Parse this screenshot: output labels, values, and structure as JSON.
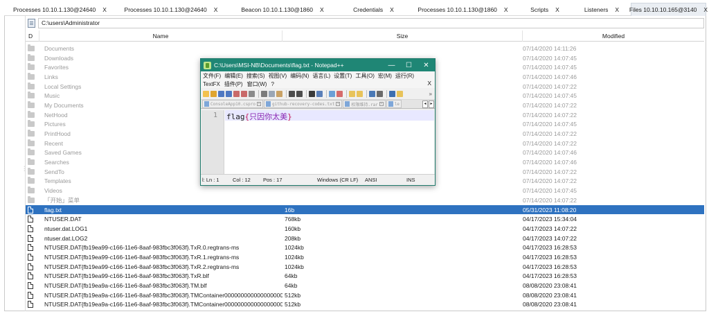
{
  "tabs": [
    {
      "label": "Processes 10.10.1.130@24640",
      "close": "X",
      "active": false
    },
    {
      "label": "Processes 10.10.1.130@24640",
      "close": "X",
      "active": false
    },
    {
      "label": "Beacon 10.10.1.130@1860",
      "close": "X",
      "active": false
    },
    {
      "label": "Credentials",
      "close": "X",
      "active": false
    },
    {
      "label": "Processes 10.10.1.130@1860",
      "close": "X",
      "active": false
    },
    {
      "label": "Scripts",
      "close": "X",
      "active": false
    },
    {
      "label": "Listeners",
      "close": "X",
      "active": false
    },
    {
      "label": "Files 10.10.10.165@3140",
      "close": "X",
      "active": true
    }
  ],
  "browser": {
    "path": "C:\\users\\Administrator",
    "columns": {
      "d": "D",
      "name": "Name",
      "size": "Size",
      "modified": "Modified"
    },
    "rows": [
      {
        "type": "folder",
        "name": "Documents",
        "size": "",
        "modified": "07/14/2020 14:11:26"
      },
      {
        "type": "folder",
        "name": "Downloads",
        "size": "",
        "modified": "07/14/2020 14:07:45"
      },
      {
        "type": "folder",
        "name": "Favorites",
        "size": "",
        "modified": "07/14/2020 14:07:45"
      },
      {
        "type": "folder",
        "name": "Links",
        "size": "",
        "modified": "07/14/2020 14:07:46"
      },
      {
        "type": "folder",
        "name": "Local Settings",
        "size": "",
        "modified": "07/14/2020 14:07:22"
      },
      {
        "type": "folder",
        "name": "Music",
        "size": "",
        "modified": "07/14/2020 14:07:45"
      },
      {
        "type": "folder",
        "name": "My Documents",
        "size": "",
        "modified": "07/14/2020 14:07:22"
      },
      {
        "type": "folder",
        "name": "NetHood",
        "size": "",
        "modified": "07/14/2020 14:07:22"
      },
      {
        "type": "folder",
        "name": "Pictures",
        "size": "",
        "modified": "07/14/2020 14:07:45"
      },
      {
        "type": "folder",
        "name": "PrintHood",
        "size": "",
        "modified": "07/14/2020 14:07:22"
      },
      {
        "type": "folder",
        "name": "Recent",
        "size": "",
        "modified": "07/14/2020 14:07:22"
      },
      {
        "type": "folder",
        "name": "Saved Games",
        "size": "",
        "modified": "07/14/2020 14:07:46"
      },
      {
        "type": "folder",
        "name": "Searches",
        "size": "",
        "modified": "07/14/2020 14:07:46"
      },
      {
        "type": "folder",
        "name": "SendTo",
        "size": "",
        "modified": "07/14/2020 14:07:22"
      },
      {
        "type": "folder",
        "name": "Templates",
        "size": "",
        "modified": "07/14/2020 14:07:22"
      },
      {
        "type": "folder",
        "name": "Videos",
        "size": "",
        "modified": "07/14/2020 14:07:45"
      },
      {
        "type": "folder",
        "name": "「开始」菜单",
        "size": "",
        "modified": "07/14/2020 14:07:22"
      },
      {
        "type": "file",
        "name": "flag.txt",
        "size": "16b",
        "modified": "05/31/2023 11:08:20",
        "selected": true
      },
      {
        "type": "file",
        "name": "NTUSER.DAT",
        "size": "768kb",
        "modified": "04/17/2023 15:34:04"
      },
      {
        "type": "file",
        "name": "ntuser.dat.LOG1",
        "size": "160kb",
        "modified": "04/17/2023 14:07:22"
      },
      {
        "type": "file",
        "name": "ntuser.dat.LOG2",
        "size": "208kb",
        "modified": "04/17/2023 14:07:22"
      },
      {
        "type": "file",
        "name": "NTUSER.DAT{fb19ea99-c166-11e6-8aaf-983fbc3f063f}.TxR.0.regtrans-ms",
        "size": "1024kb",
        "modified": "04/17/2023 16:28:53"
      },
      {
        "type": "file",
        "name": "NTUSER.DAT{fb19ea99-c166-11e6-8aaf-983fbc3f063f}.TxR.1.regtrans-ms",
        "size": "1024kb",
        "modified": "04/17/2023 16:28:53"
      },
      {
        "type": "file",
        "name": "NTUSER.DAT{fb19ea99-c166-11e6-8aaf-983fbc3f063f}.TxR.2.regtrans-ms",
        "size": "1024kb",
        "modified": "04/17/2023 16:28:53"
      },
      {
        "type": "file",
        "name": "NTUSER.DAT{fb19ea99-c166-11e6-8aaf-983fbc3f063f}.TxR.blf",
        "size": "64kb",
        "modified": "04/17/2023 16:28:53"
      },
      {
        "type": "file",
        "name": "NTUSER.DAT{fb19ea9a-c166-11e6-8aaf-983fbc3f063f}.TM.blf",
        "size": "64kb",
        "modified": "08/08/2020 23:08:41"
      },
      {
        "type": "file",
        "name": "NTUSER.DAT{fb19ea9a-c166-11e6-8aaf-983fbc3f063f}.TMContainer00000000000000000001.r...",
        "size": "512kb",
        "modified": "08/08/2020 23:08:41"
      },
      {
        "type": "file",
        "name": "NTUSER.DAT{fb19ea9a-c166-11e6-8aaf-983fbc3f063f}.TMContainer00000000000000000002.r...",
        "size": "512kb",
        "modified": "08/08/2020 23:08:41"
      }
    ]
  },
  "notepad": {
    "title": "C:\\Users\\MSI-NB\\Documents\\flag.txt - Notepad++",
    "window_buttons": {
      "minimize": "—",
      "maximize": "☐",
      "close": "✕"
    },
    "menu": [
      "文件(F)",
      "编辑(E)",
      "搜索(S)",
      "视图(V)",
      "编码(N)",
      "语言(L)",
      "设置(T)",
      "工具(O)",
      "宏(M)",
      "运行(R)"
    ],
    "menu2": [
      "TextFX",
      "插件(P)",
      "窗口(W)",
      "?"
    ],
    "menu_close": "X",
    "toolbar_more": "»",
    "file_tabs": [
      "ConsoleApp10.cspro",
      "github-recovery-codes.txt",
      "权限维持.rar",
      "le"
    ],
    "tab_nav": {
      "prev": "◂",
      "next": "▸"
    },
    "line_number": "1",
    "code": {
      "prefix": "flag",
      "open": "{",
      "inner": "只因你太美",
      "close": "}"
    },
    "status": {
      "left": "l: Ln : 1",
      "col": "Col : 12",
      "pos": "Pos : 17",
      "eol": "Windows (CR LF)",
      "enc": "ANSI",
      "ins": "INS"
    }
  }
}
